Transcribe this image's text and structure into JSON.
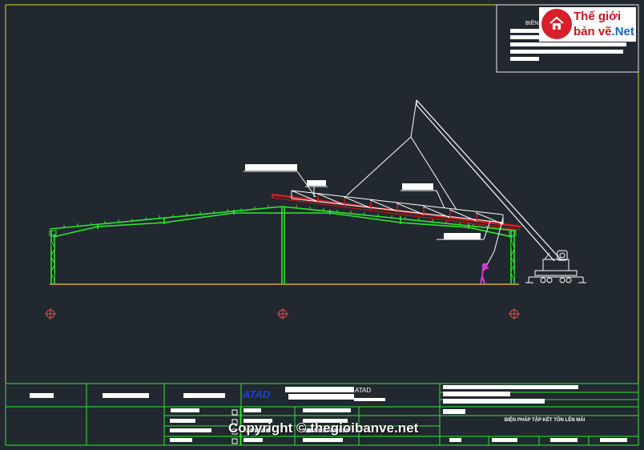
{
  "logo": {
    "line1": "Thế giới",
    "line2a": "bản vẽ",
    "line2b": ".Net"
  },
  "title_block": {
    "corner_label": "BIÊN",
    "company_mark": "ATAD",
    "company_mark_2": "ATAD",
    "drawing_title": "BIỆN PHÁP TẬP KẾT TÔN LÊN MÁI"
  },
  "watermark": "Copyright © thegioibanve.net",
  "colors": {
    "background": "#212830",
    "frame": "#d6d636",
    "structure": "#2ee82e",
    "truss": "#d81e1e",
    "crane": "#ffffff",
    "worker": "#d63ad6",
    "grid_marker": "#e05050"
  }
}
